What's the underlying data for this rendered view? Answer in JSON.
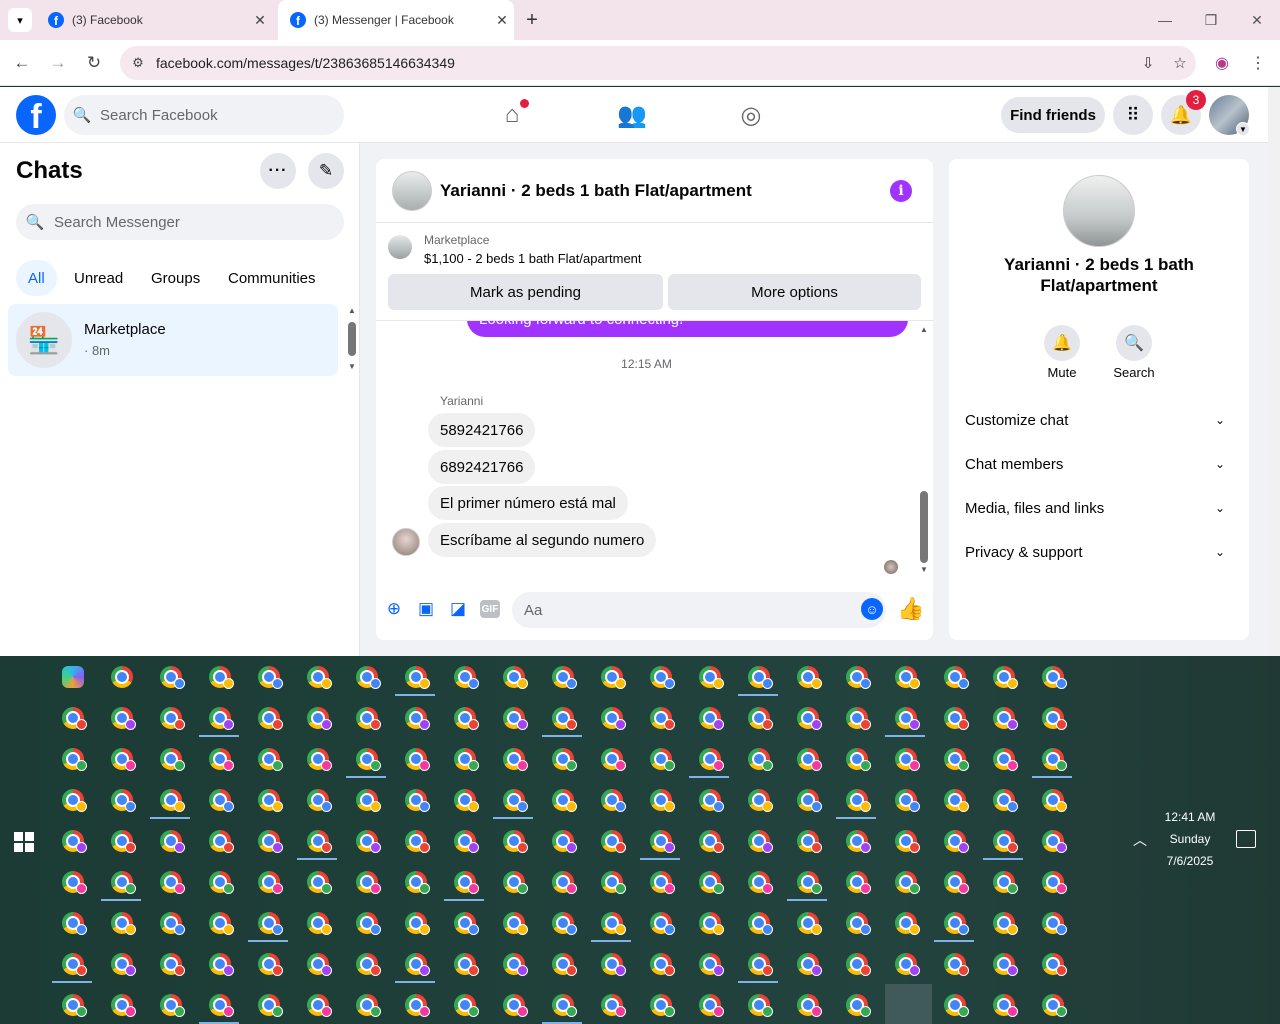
{
  "browser": {
    "tabs": [
      {
        "title": "(3) Facebook",
        "active": false
      },
      {
        "title": "(3) Messenger | Facebook",
        "active": true
      }
    ],
    "url": "facebook.com/messages/t/23863685146634349",
    "new_tab_label": "+"
  },
  "facebook": {
    "logo": "f",
    "search_placeholder": "Search Facebook",
    "find_friends": "Find friends",
    "notification_count": "3"
  },
  "sidebar": {
    "title": "Chats",
    "search_placeholder": "Search Messenger",
    "filters": [
      {
        "label": "All",
        "active": true
      },
      {
        "label": "Unread",
        "active": false
      },
      {
        "label": "Groups",
        "active": false
      },
      {
        "label": "Communities",
        "active": false
      }
    ],
    "chat_items": [
      {
        "name": "Marketplace",
        "time": "· 8m"
      }
    ]
  },
  "conversation": {
    "title": "Yarianni · 2 beds 1 bath Flat/apartment",
    "marketplace_label": "Marketplace",
    "listing": "$1,100 - 2 beds 1 bath Flat/apartment",
    "mark_pending": "Mark as pending",
    "more_options": "More options",
    "sent_message": "Looking forward to connecting!",
    "timestamp": "12:15 AM",
    "sender_name": "Yarianni",
    "messages": [
      "5892421766",
      "6892421766",
      "El primer número está mal",
      "Escríbame al segundo numero"
    ],
    "input_placeholder": "Aa",
    "gif_label": "GIF"
  },
  "info_panel": {
    "name": "Yarianni · 2 beds 1 bath Flat/apartment",
    "mute_label": "Mute",
    "search_label": "Search",
    "sections": [
      "Customize chat",
      "Chat members",
      "Media, files and links",
      "Privacy & support"
    ]
  },
  "taskbar": {
    "time": "12:41 AM",
    "day": "Sunday",
    "date": "7/6/2025"
  },
  "colors": {
    "accent": "#0866ff",
    "messenger_purple": "#a033ff",
    "selected_bg": "#ebf5ff",
    "badge_red": "#e41e3f"
  }
}
